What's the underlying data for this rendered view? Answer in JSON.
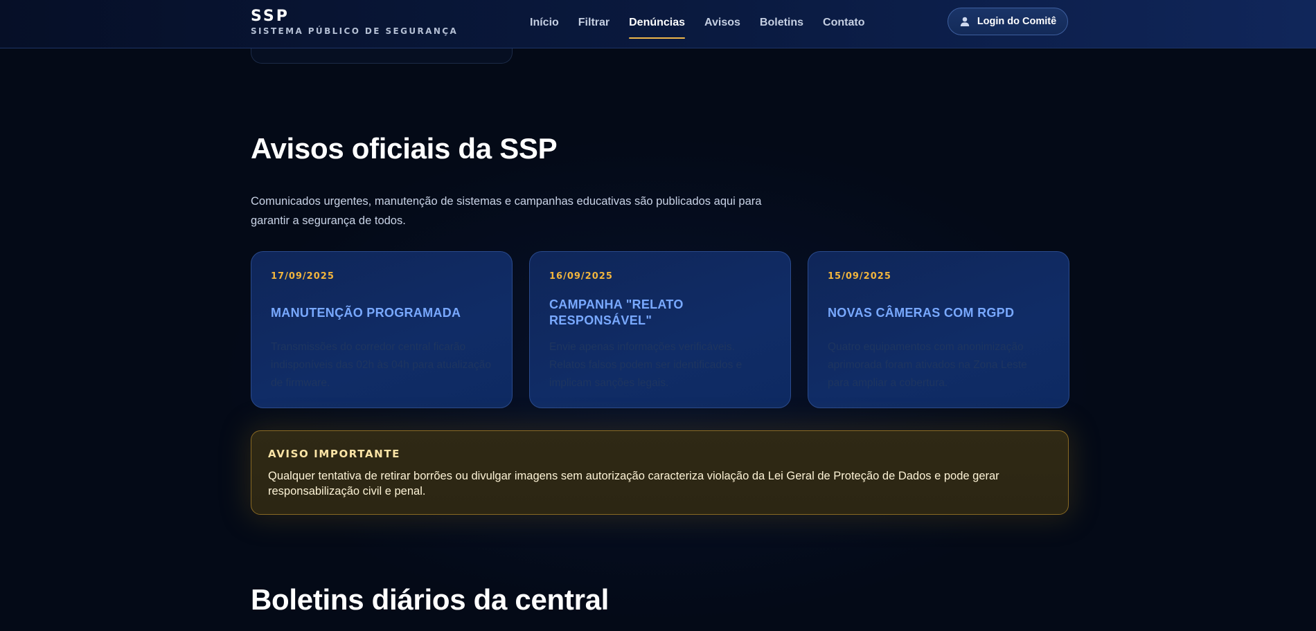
{
  "header": {
    "brand_name": "SSP",
    "brand_sub": "SISTEMA PÚBLICO DE SEGURANÇA",
    "nav": [
      {
        "label": "Início",
        "active": false
      },
      {
        "label": "Filtrar",
        "active": false
      },
      {
        "label": "Denúncias",
        "active": true
      },
      {
        "label": "Avisos",
        "active": false
      },
      {
        "label": "Boletins",
        "active": false
      },
      {
        "label": "Contato",
        "active": false
      }
    ],
    "login_label": "Login do Comitê",
    "login_icon": "user-icon"
  },
  "avisos": {
    "title": "Avisos oficiais da SSP",
    "description": "Comunicados urgentes, manutenção de sistemas e campanhas educativas são publicados aqui para garantir a segurança de todos.",
    "cards": [
      {
        "date": "17/09/2025",
        "title": "MANUTENÇÃO PROGRAMADA",
        "text": "Transmissões do corredor central ficarão indisponíveis das 02h às 04h para atualização de firmware."
      },
      {
        "date": "16/09/2025",
        "title": "CAMPANHA \"RELATO RESPONSÁVEL\"",
        "text": "Envie apenas informações verificáveis. Relatos falsos podem ser identificados e implicam sanções legais."
      },
      {
        "date": "15/09/2025",
        "title": "NOVAS CÂMERAS COM RGPD",
        "text": "Quatro equipamentos com anonimização aprimorada foram ativados na Zona Leste para ampliar a cobertura."
      }
    ],
    "warning": {
      "title": "AVISO IMPORTANTE",
      "text": "Qualquer tentativa de retirar borrões ou divulgar imagens sem autorização caracteriza violação da Lei Geral de Proteção de Dados e pode gerar responsabilização civil e penal."
    }
  },
  "boletins": {
    "title": "Boletins diários da central"
  },
  "colors": {
    "accent_gold": "#f2b53c",
    "card_title_blue": "#79a9ff",
    "background": "#040a17"
  }
}
